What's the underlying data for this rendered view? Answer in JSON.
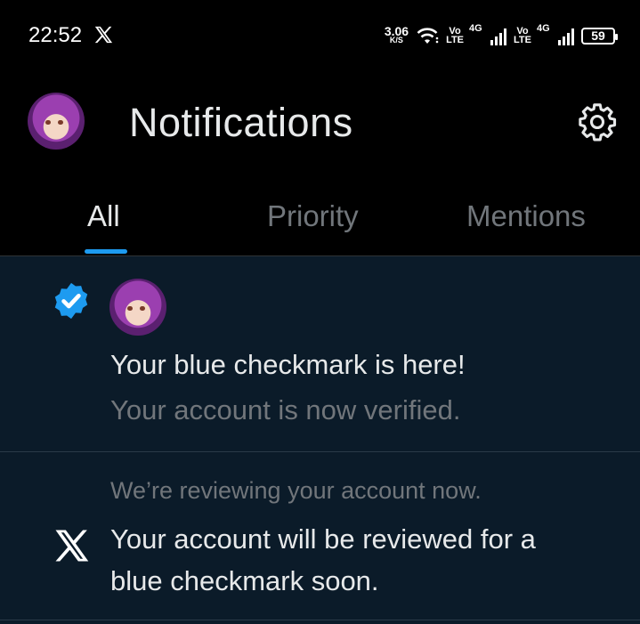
{
  "status_bar": {
    "time": "22:52",
    "speed_value": "3.06",
    "speed_unit": "K/S",
    "sim1_vo": "Vo",
    "sim1_lte": "LTE",
    "sim1_net": "4G",
    "sim2_vo": "Vo",
    "sim2_lte": "LTE",
    "sim2_net": "4G",
    "battery": "59",
    "icons": [
      "x-logo-icon",
      "wifi-icon",
      "signal-icon",
      "battery-icon"
    ]
  },
  "header": {
    "title": "Notifications",
    "icons": [
      "avatar",
      "gear-icon"
    ]
  },
  "tabs": [
    {
      "label": "All",
      "active": true
    },
    {
      "label": "Priority",
      "active": false
    },
    {
      "label": "Mentions",
      "active": false
    }
  ],
  "notifications": [
    {
      "icon": "verified-badge-icon",
      "title": "Your blue checkmark is here!",
      "subtitle": "Your account is now verified."
    },
    {
      "icon": "x-logo-icon",
      "subtitle": "We’re reviewing your account now.",
      "title_line1": "Your account will be reviewed for a",
      "title_line2": "blue checkmark soon."
    }
  ],
  "colors": {
    "background": "#000000",
    "list_background": "#0b1b29",
    "accent": "#1d9bf0",
    "primary_text": "#e7e9ea",
    "secondary_text": "#71767b"
  }
}
